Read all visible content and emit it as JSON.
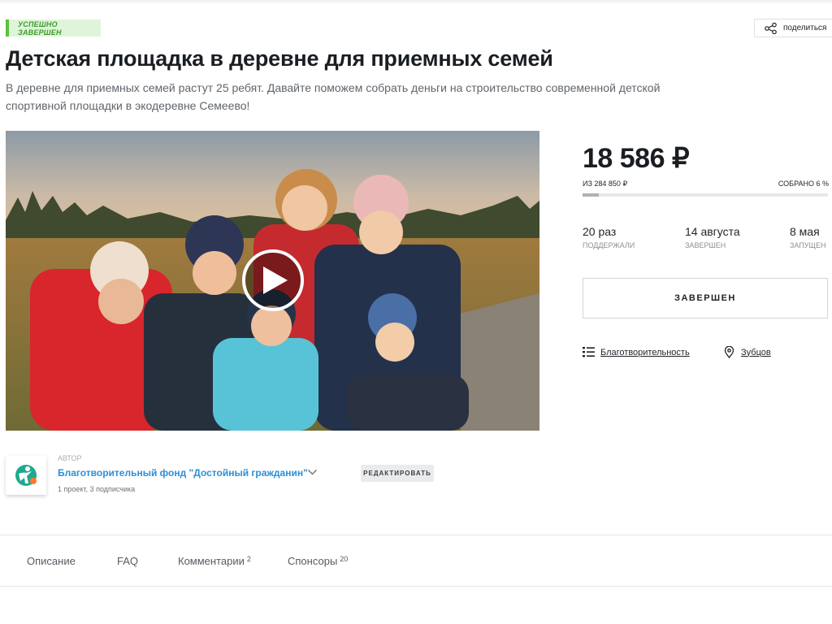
{
  "project": {
    "status": "УСПЕШНО ЗАВЕРШЕН",
    "title": "Детская площадка в деревне для приемных семей",
    "description": "В деревне для приемных семей растут 25 ребят. Давайте поможем собрать деньги на строительство современной детской спортивной площадки в экодеревне Семеево!"
  },
  "header": {
    "share_label": "поделиться"
  },
  "funding": {
    "raised": "18 586 ₽",
    "goal": "ИЗ 284 850 ₽",
    "collected_label": "СОБРАНО 6 %",
    "progress_fraction": 0.065
  },
  "stats": {
    "backers_value": "20 раз",
    "backers_label": "ПОДДЕРЖАЛИ",
    "ended_value": "14 августа",
    "ended_label": "ЗАВЕРШЕН",
    "launched_value": "8 мая",
    "launched_label": "ЗАПУЩЕН"
  },
  "action": {
    "finished_label": "ЗАВЕРШЕН"
  },
  "meta": {
    "category": "Благотворительность",
    "location": "Зубцов"
  },
  "author": {
    "caption": "АВТОР",
    "name": "Благотворительный фонд \"Достойный гражданин\"",
    "stats": "1 проект, 3 подписчика",
    "edit_label": "РЕДАКТИРОВАТЬ"
  },
  "tabs": [
    {
      "label": "Описание",
      "count": ""
    },
    {
      "label": "FAQ",
      "count": ""
    },
    {
      "label": "Комментарии",
      "count": "2"
    },
    {
      "label": "Спонсоры",
      "count": "20"
    }
  ],
  "colors": {
    "status_green": "#58c23e",
    "link_blue": "#2b8fd6",
    "logo_teal": "#1fa88f"
  },
  "icons": {
    "share": "share-icon",
    "play": "play-icon",
    "category": "list-icon",
    "location": "map-pin-icon",
    "chevron": "chevron-down-icon"
  }
}
